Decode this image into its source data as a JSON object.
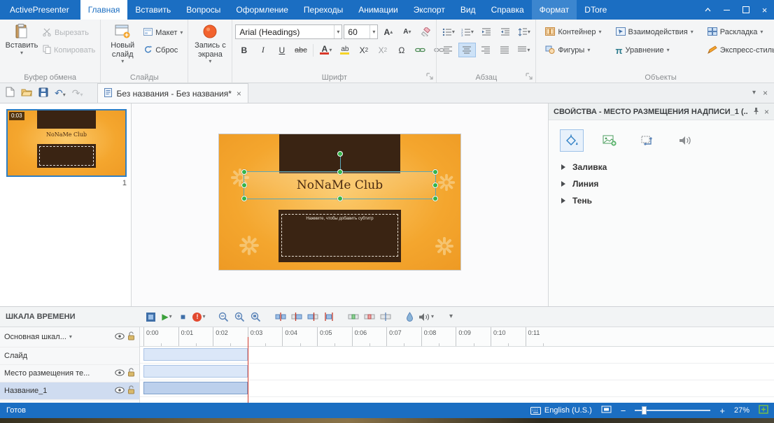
{
  "titlebar": {
    "app_name": "ActivePresenter",
    "tabs": [
      {
        "label": "Главная",
        "state": "active"
      },
      {
        "label": "Вставить"
      },
      {
        "label": "Вопросы"
      },
      {
        "label": "Оформление"
      },
      {
        "label": "Переходы"
      },
      {
        "label": "Анимации"
      },
      {
        "label": "Экспорт"
      },
      {
        "label": "Вид"
      },
      {
        "label": "Справка"
      },
      {
        "label": "Формат",
        "state": "contextual"
      },
      {
        "label": "DTore"
      }
    ]
  },
  "ribbon": {
    "clipboard": {
      "group": "Буфер обмена",
      "paste": "Вставить",
      "cut": "Вырезать",
      "copy": "Копировать"
    },
    "slides": {
      "group": "Слайды",
      "new_slide": "Новый слайд",
      "layout": "Макет",
      "reset": "Сброс"
    },
    "record": {
      "label": "Запись с экрана"
    },
    "font": {
      "group": "Шрифт",
      "family": "Arial (Headings)",
      "size": "60",
      "bold": "B",
      "italic": "I",
      "underline": "U",
      "strike": "abc",
      "color_letter": "A",
      "highlight": "ab",
      "sup_base": "X",
      "sup_exp": "2",
      "sub_base": "X",
      "sub_exp": "2",
      "symbol": "Ω"
    },
    "paragraph": {
      "group": "Абзац"
    },
    "objects": {
      "group": "Объекты",
      "container": "Контейнер",
      "interactions": "Взаимодействия",
      "layout": "Раскладка",
      "shapes": "Фигуры",
      "equation": "Уравнение",
      "quick_style": "Экспресс-стиль",
      "pi": "π"
    }
  },
  "document_tab": {
    "title": "Без названия - Без названия*"
  },
  "slide_panel": {
    "duration": "0:03",
    "number": "1"
  },
  "canvas": {
    "title": "NoNaMe Club",
    "subtitle_placeholder": "Нажмите, чтобы добавить субтитр"
  },
  "properties": {
    "title": "СВОЙСТВА - МЕСТО РАЗМЕЩЕНИЯ НАДПИСИ_1 (...",
    "sections": {
      "fill": "Заливка",
      "line": "Линия",
      "shadow": "Тень"
    }
  },
  "timeline": {
    "title": "ШКАЛА ВРЕМЕНИ",
    "scale_selector": "Основная шкал...",
    "ruler": [
      "0:00",
      "0:01",
      "0:02",
      "0:03",
      "0:04",
      "0:05",
      "0:06",
      "0:07",
      "0:08",
      "0:09",
      "0:10",
      "0:11"
    ],
    "tracks": [
      {
        "name": "Слайд"
      },
      {
        "name": "Место размещения те..."
      },
      {
        "name": "Название_1"
      }
    ]
  },
  "statusbar": {
    "status": "Готов",
    "language": "English (U.S.)",
    "zoom": "27%"
  },
  "colors": {
    "accent": "#1b6ec2",
    "record_red": "#e2492f",
    "handle_green": "#35b44a",
    "slide_orange": "#f4a62e",
    "slide_brown": "#3a2413"
  }
}
